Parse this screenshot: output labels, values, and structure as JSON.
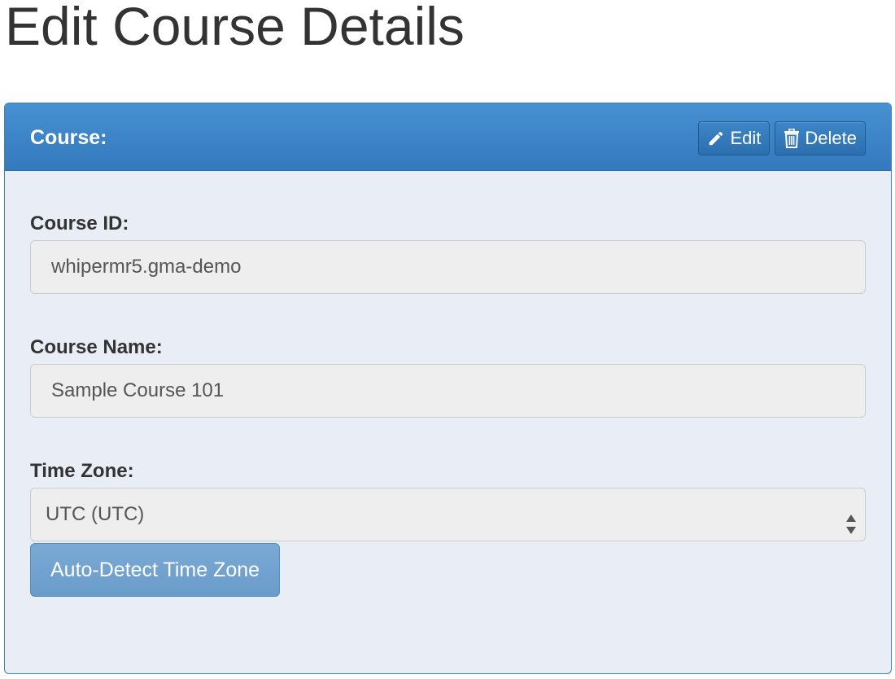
{
  "page": {
    "title": "Edit Course Details"
  },
  "panel": {
    "title": "Course:",
    "actions": {
      "edit_label": "Edit",
      "delete_label": "Delete"
    }
  },
  "form": {
    "course_id": {
      "label": "Course ID:",
      "value": "whipermr5.gma-demo"
    },
    "course_name": {
      "label": "Course Name:",
      "value": "Sample Course 101"
    },
    "time_zone": {
      "label": "Time Zone:",
      "selected": "UTC (UTC)"
    },
    "auto_detect_label": "Auto-Detect Time Zone"
  },
  "colors": {
    "panel_heading": "#3a84c6",
    "panel_body": "#e9eef6",
    "input_background": "#eeeeee",
    "button_disabled": "#72a3d0"
  },
  "icons": {
    "edit": "pencil-icon",
    "delete": "trash-icon",
    "select": "select-arrows-icon"
  }
}
